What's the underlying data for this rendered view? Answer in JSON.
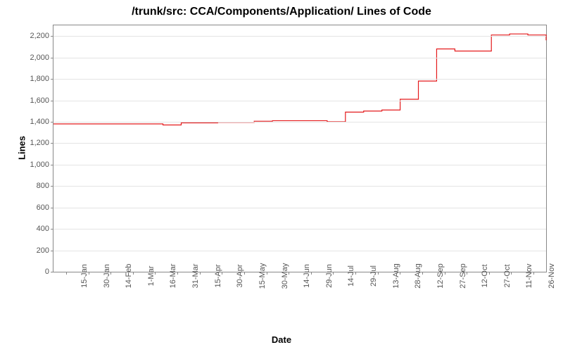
{
  "chart_data": {
    "type": "line",
    "title": "/trunk/src: CCA/Components/Application/ Lines of Code",
    "xlabel": "Date",
    "ylabel": "Lines",
    "ylim": [
      0,
      2300
    ],
    "y_ticks": [
      0,
      200,
      400,
      600,
      800,
      1000,
      1200,
      1400,
      1600,
      1800,
      2000,
      2200
    ],
    "y_tick_labels": [
      "0",
      "200",
      "400",
      "600",
      "800",
      "1,000",
      "1,200",
      "1,400",
      "1,600",
      "1,800",
      "2,000",
      "2,200"
    ],
    "categories": [
      "15-Jan",
      "30-Jan",
      "14-Feb",
      "1-Mar",
      "16-Mar",
      "31-Mar",
      "15-Apr",
      "30-Apr",
      "15-May",
      "30-May",
      "14-Jun",
      "29-Jun",
      "14-Jul",
      "29-Jul",
      "13-Aug",
      "28-Aug",
      "12-Sep",
      "27-Sep",
      "12-Oct",
      "27-Oct",
      "11-Nov",
      "26-Nov"
    ],
    "series": [
      {
        "name": "Lines of Code",
        "color": "#e41a1c",
        "x": [
          "1-Jan",
          "15-Jan",
          "30-Jan",
          "14-Feb",
          "1-Mar",
          "16-Mar",
          "23-Mar",
          "31-Mar",
          "15-Apr",
          "30-Apr",
          "15-May",
          "30-May",
          "14-Jun",
          "29-Jun",
          "14-Jul",
          "29-Jul",
          "5-Aug",
          "13-Aug",
          "20-Aug",
          "28-Aug",
          "3-Sep",
          "12-Sep",
          "27-Sep",
          "12-Oct",
          "27-Oct",
          "11-Nov",
          "18-Nov",
          "26-Nov"
        ],
        "values": [
          1380,
          1380,
          1380,
          1380,
          1380,
          1380,
          1370,
          1390,
          1390,
          1395,
          1395,
          1405,
          1410,
          1410,
          1410,
          1400,
          1490,
          1500,
          1510,
          1610,
          1780,
          2080,
          2060,
          2060,
          2210,
          2220,
          2210,
          2160
        ]
      }
    ]
  }
}
